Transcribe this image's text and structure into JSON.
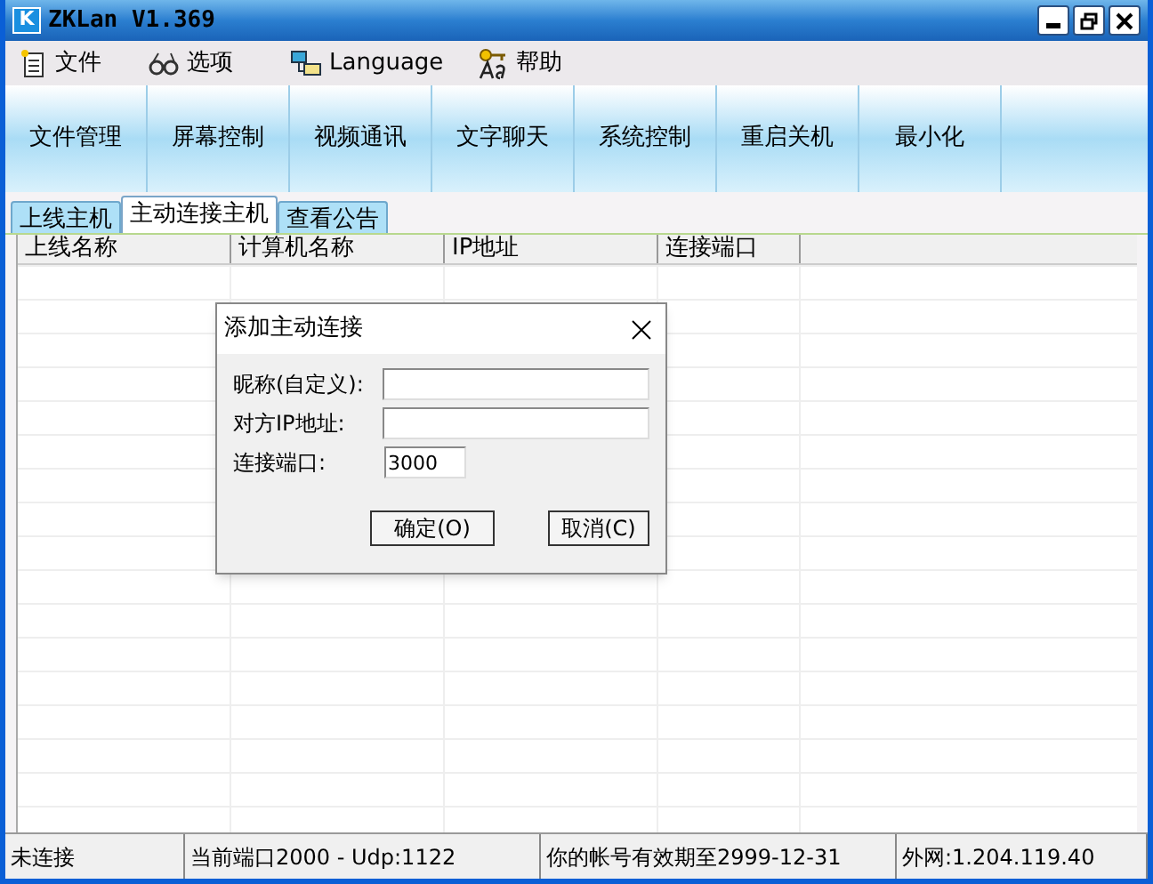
{
  "window": {
    "title": "ZKLan V1.369",
    "logo": "K"
  },
  "menu": [
    {
      "label": "文件",
      "kind": "file"
    },
    {
      "label": "选项",
      "kind": "options"
    },
    {
      "label": "Language",
      "kind": "language"
    },
    {
      "label": "帮助",
      "kind": "help"
    }
  ],
  "toolbar": [
    "文件管理",
    "屏幕控制",
    "视频通讯",
    "文字聊天",
    "系统控制",
    "重启关机",
    "最小化"
  ],
  "tabs": [
    {
      "label": "上线主机",
      "selected": false
    },
    {
      "label": "主动连接主机",
      "selected": true
    },
    {
      "label": "查看公告",
      "selected": false
    }
  ],
  "table": {
    "columns": [
      "上线名称",
      "计算机名称",
      "IP地址",
      "连接端口"
    ]
  },
  "dialog": {
    "title": "添加主动连接",
    "fields": [
      {
        "label": "昵称(自定义):"
      },
      {
        "label": "对方IP地址:"
      },
      {
        "label": "连接端口:",
        "value": "3000"
      }
    ],
    "buttons": [
      "确定(O)",
      "取消(C)"
    ]
  },
  "status_bar": [
    "未连接",
    "当前端口2000 - Udp:1122",
    "你的帐号有效期至2999-12-31",
    "外网:1.204.119.40"
  ]
}
